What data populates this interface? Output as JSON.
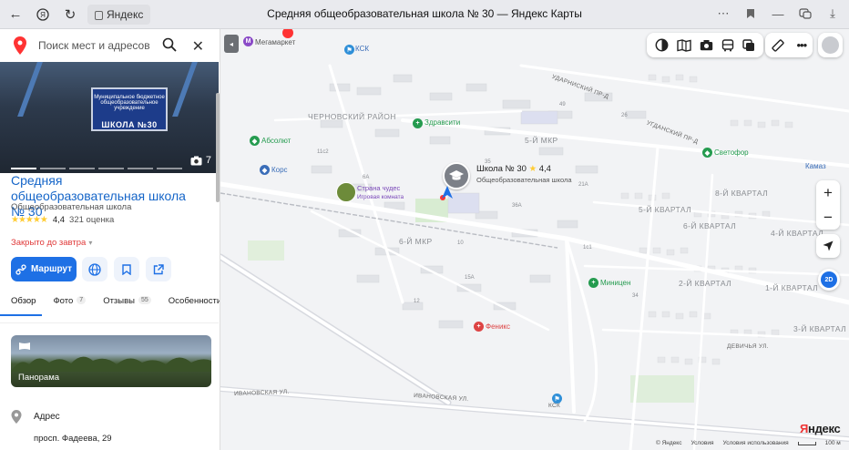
{
  "browser": {
    "address": "Яндекс",
    "title": "Средняя общеобразовательная школа № 30 — Яндекс Карты"
  },
  "search": {
    "placeholder": "Поиск мест и адресов"
  },
  "place": {
    "photo_count": "7",
    "sign_small": "Муниципальное бюджетное общеобразовательное учреждение",
    "sign_big": "ШКОЛА №30",
    "title": "Средняя общеобразовательная школа № 30",
    "category": "Общеобразовательная школа",
    "stars": "★★★★★",
    "rating": "4,4",
    "rating_count": "321 оценка",
    "status": "Закрыто до завтра",
    "status_caret": "▾",
    "route_label": "Маршрут"
  },
  "tabs": [
    {
      "label": "Обзор",
      "count": ""
    },
    {
      "label": "Фото",
      "count": "7"
    },
    {
      "label": "Отзывы",
      "count": "55"
    },
    {
      "label": "Особенности",
      "count": ""
    }
  ],
  "panorama": {
    "label": "Панорама"
  },
  "address": {
    "label": "Адрес",
    "value": "просп. Фадеева, 29"
  },
  "map": {
    "school_name": "Школа № 30",
    "school_star": "★",
    "school_rating": "4,4",
    "school_sub": "Общеобразовательная школа",
    "zoom_in": "+",
    "zoom_out": "−",
    "mode_2d": "2D",
    "logo_first": "Я",
    "logo_rest": "ндекс",
    "copyright": "© Яндекс",
    "terms": "Условия",
    "terms_use": "Условия использования",
    "scale": "100 м",
    "labels": {
      "megamarket": "Мегамаркет",
      "ksk_top": "КСК",
      "chernovsky": "ЧЕРНОВСКИЙ РАЙОН",
      "zdravsiti": "Здравсити",
      "absolut": "Абсолют",
      "kors": "Корс",
      "strana": "Страна чудес",
      "igrovaya": "Игровая комната",
      "mkr5": "5-Й МКР",
      "mkr6": "6-Й МКР",
      "svetofor": "Светофор",
      "kamaz": "Камаз",
      "kvartal8": "8-Й КВАРТАЛ",
      "kvartal5": "5-Й КВАРТАЛ",
      "kvartal6": "6-Й КВАРТАЛ",
      "kvartal4": "4-Й КВАРТАЛ",
      "kvartal2": "2-Й КВАРТАЛ",
      "kvartal1": "1-Й КВАРТАЛ",
      "kvartal3": "3-Й КВАРТАЛ",
      "mininzen": "Миницен",
      "feniks": "Феникс",
      "udarnyy": "УДАРНИСКИЙ ПР-Д",
      "ugdansky": "УГДАНСКИЙ ПР-Д",
      "devichya": "ДЕВИЧЬЯ УЛ.",
      "ivanovskaya1": "ИВАНОВСКАЯ УЛ.",
      "ivanovskaya2": "ИВАНОВСКАЯ УЛ.",
      "ksk_bottom": "КСК",
      "n11c2": "11с2",
      "n6a": "6А",
      "n35": "35",
      "n36a": "36А",
      "n21a": "21А",
      "n15a": "15А",
      "n1c1": "1с1",
      "n34": "34",
      "n12": "12",
      "n10": "10",
      "n26": "26",
      "n49": "49"
    }
  }
}
